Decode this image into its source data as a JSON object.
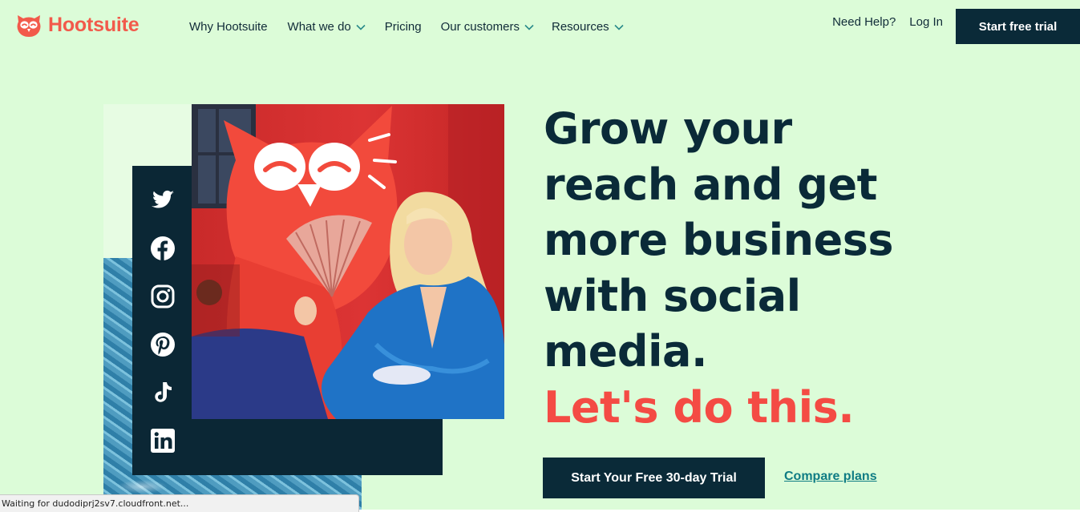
{
  "brand": {
    "name": "Hootsuite",
    "color": "#f25a4b"
  },
  "nav": {
    "items": [
      {
        "label": "Why Hootsuite",
        "has_dropdown": false
      },
      {
        "label": "What we do",
        "has_dropdown": true
      },
      {
        "label": "Pricing",
        "has_dropdown": false
      },
      {
        "label": "Our customers",
        "has_dropdown": true
      },
      {
        "label": "Resources",
        "has_dropdown": true
      }
    ],
    "help_label": "Need Help?",
    "login_label": "Log In",
    "cta_label": "Start free trial"
  },
  "hero": {
    "headline_lines": [
      "Grow your",
      "reach and get",
      "more business",
      "with social",
      "media."
    ],
    "accent_line": "Let's do this.",
    "cta_label": "Start Your Free 30-day Trial",
    "secondary_link": "Compare plans",
    "social_icons": [
      "twitter-icon",
      "facebook-icon",
      "instagram-icon",
      "pinterest-icon",
      "tiktok-icon",
      "linkedin-icon"
    ]
  },
  "status_bar": {
    "text": "Waiting for dudodiprj2sv7.cloudfront.net..."
  },
  "colors": {
    "background": "#dcfcd8",
    "navy": "#0a2a38",
    "accent_red": "#f44b44",
    "link_teal": "#0f7c84"
  }
}
